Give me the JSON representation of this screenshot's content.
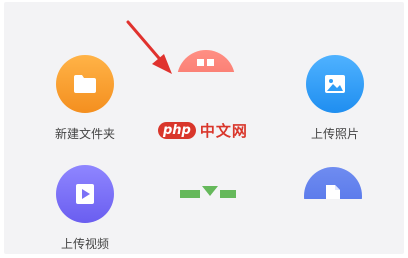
{
  "grid": {
    "new_folder": {
      "label": "新建文件夹",
      "icon": "folder-icon",
      "color": "#f7a235"
    },
    "upload_photo": {
      "label": "上传照片",
      "icon": "image-icon",
      "color": "#2f9df6"
    },
    "upload_video": {
      "label": "上传视频",
      "icon": "play-icon",
      "color": "#7b71f6"
    },
    "partial_top": {
      "color": "#f57a6f"
    },
    "partial_doc": {
      "icon": "document-icon",
      "color": "#5b7cec"
    },
    "partial_green": {
      "color": "#65b85b"
    }
  },
  "annotation": {
    "arrow_color": "#e0322e"
  },
  "watermark": {
    "badge": "php",
    "text": "中文网",
    "color": "#d9362b"
  }
}
